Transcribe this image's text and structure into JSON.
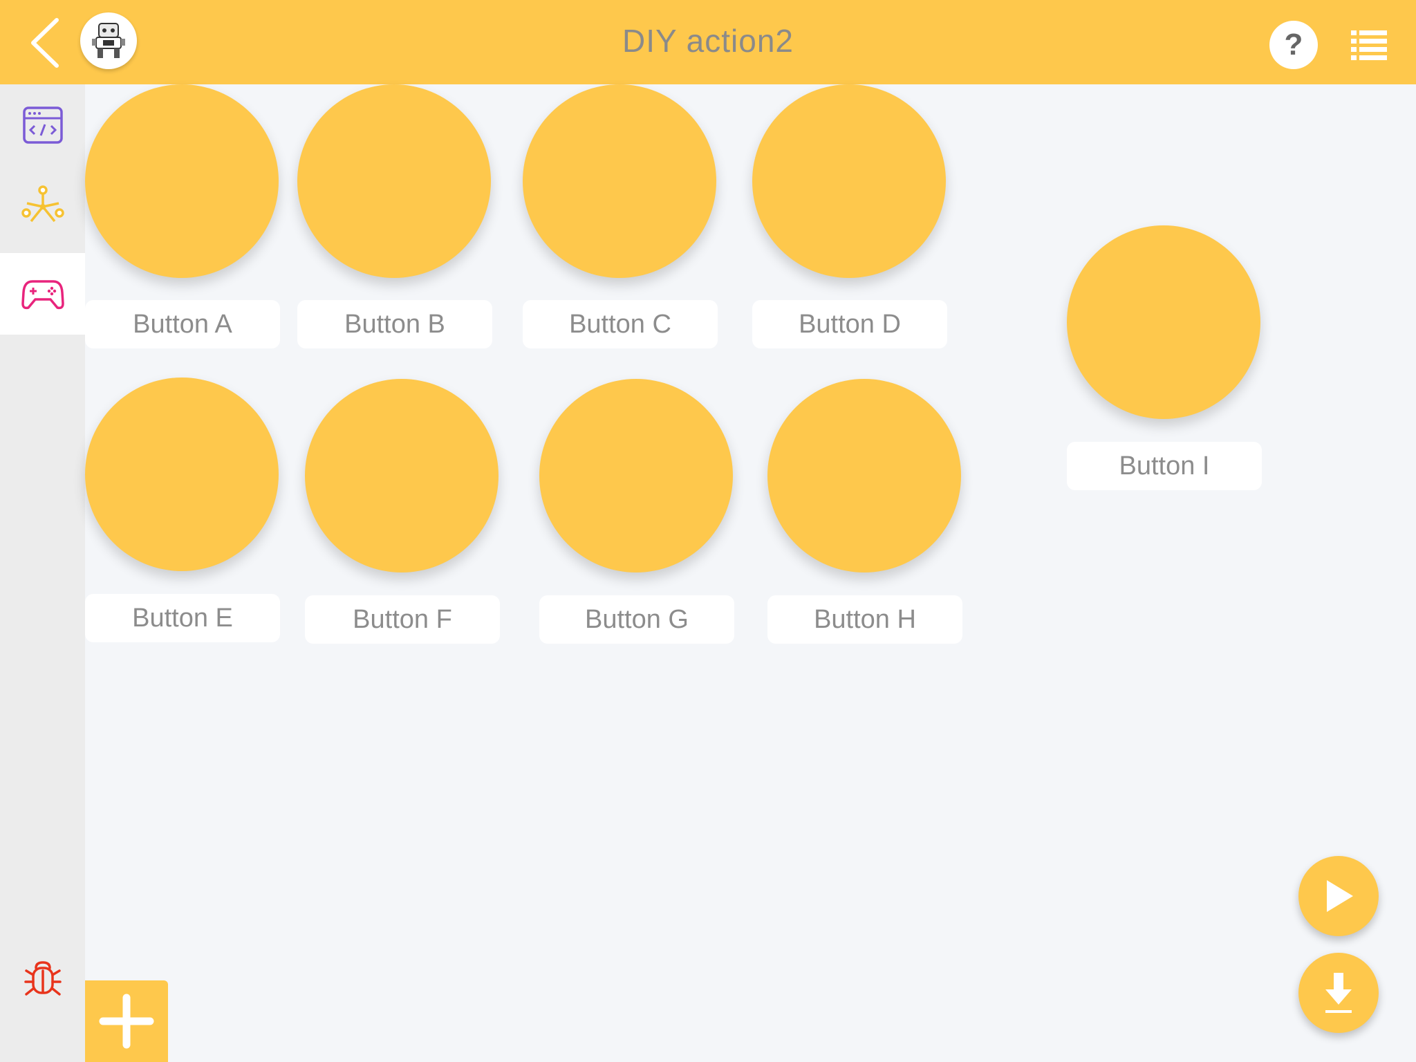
{
  "header": {
    "title": "DIY action2",
    "help_label": "?",
    "background": "#fec84c",
    "icons": [
      "back-arrow-icon",
      "robot-avatar",
      "help-icon",
      "list-menu-icon"
    ]
  },
  "sidebar": {
    "items": [
      {
        "name": "code-editor",
        "icon": "code-window-icon",
        "color": "#7b5bd6",
        "active": false
      },
      {
        "name": "connection",
        "icon": "hub-nodes-icon",
        "color": "#f6c232",
        "active": false
      },
      {
        "name": "controller",
        "icon": "gamepad-icon",
        "color": "#e8247c",
        "active": true
      },
      {
        "name": "debug",
        "icon": "bug-icon",
        "color": "#e8341c",
        "active": false
      }
    ]
  },
  "buttons": [
    {
      "label": "Button A"
    },
    {
      "label": "Button B"
    },
    {
      "label": "Button C"
    },
    {
      "label": "Button D"
    },
    {
      "label": "Button E"
    },
    {
      "label": "Button F"
    },
    {
      "label": "Button G"
    },
    {
      "label": "Button H"
    },
    {
      "label": "Button I"
    }
  ],
  "actions": {
    "add_icon": "plus-icon",
    "run_icon": "play-icon",
    "download_icon": "download-icon",
    "accent": "#fec84c"
  }
}
